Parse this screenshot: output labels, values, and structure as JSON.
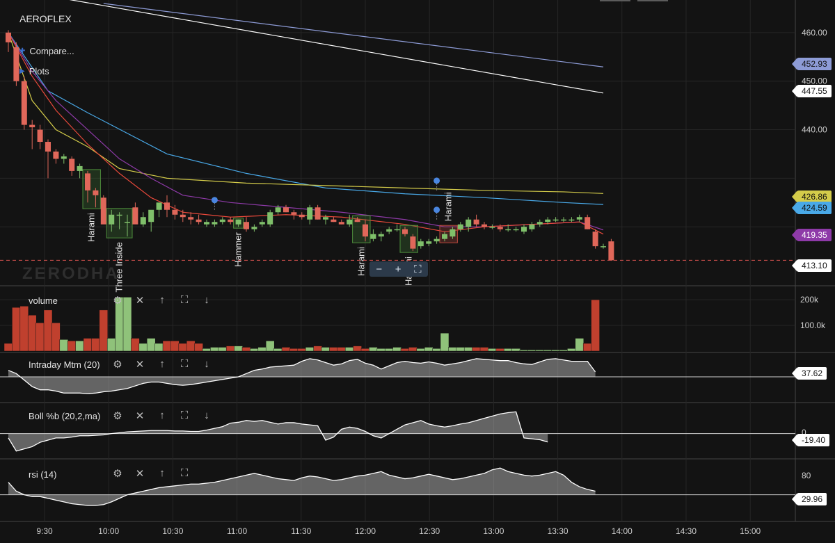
{
  "app": {
    "symbol": "AEROFLEX",
    "watermark": "ZERODHA",
    "menu": [
      {
        "label": "Compare..."
      },
      {
        "label": "Plots"
      }
    ]
  },
  "panes": {
    "volume": {
      "label": "volume"
    },
    "mtm": {
      "label": "Intraday Mtm (20)"
    },
    "boll": {
      "label": "Boll %b (20,2,ma)"
    },
    "rsi": {
      "label": "rsi (14)"
    }
  },
  "tools": {
    "settings": "⚙",
    "close": "✕",
    "up": "↑",
    "expand": "⛶",
    "down": "↓"
  },
  "zoom": {
    "minus": "−",
    "plus": "+",
    "reset": "⛶"
  },
  "price_tags": [
    {
      "value": "452.93",
      "color": "#8d9bd6",
      "text_color": "#111111"
    },
    {
      "value": "447.55",
      "color": "#ffffff",
      "text_color": "#111111"
    },
    {
      "value": "426.86",
      "color": "#d4cc4a",
      "text_color": "#111111"
    },
    {
      "value": "424.59",
      "color": "#49a9e8",
      "text_color": "#111111"
    },
    {
      "value": "419.35",
      "color": "#8e3aa8",
      "text_color": "#ffffff"
    },
    {
      "value": "413.10",
      "color": "#ffffff",
      "text_color": "#111111"
    }
  ],
  "indicator_tags": {
    "mtm": "37.62",
    "boll": "-19.40",
    "rsi": "29.96"
  },
  "chart_data": {
    "type": "candlestick",
    "symbol": "AEROFLEX",
    "ylim": [
      408,
      466
    ],
    "y_ticks": [
      440,
      450,
      460
    ],
    "y_tick_labels": [
      "440.00",
      "450.00",
      "460.00"
    ],
    "x_ticks": [
      "9:30",
      "10:00",
      "10:30",
      "11:00",
      "11:30",
      "12:00",
      "12:30",
      "13:00",
      "13:30",
      "14:00",
      "14:30",
      "15:00"
    ],
    "candles": [
      {
        "o": 460,
        "h": 460.5,
        "l": 456,
        "c": 458
      },
      {
        "o": 457,
        "h": 458,
        "l": 449,
        "c": 450
      },
      {
        "o": 450,
        "h": 451,
        "l": 440,
        "c": 441
      },
      {
        "o": 441,
        "h": 442,
        "l": 436,
        "c": 440.5
      },
      {
        "o": 440,
        "h": 441,
        "l": 436,
        "c": 437.5
      },
      {
        "o": 437.5,
        "h": 438,
        "l": 430,
        "c": 435.5
      },
      {
        "o": 435.5,
        "h": 436,
        "l": 433,
        "c": 434
      },
      {
        "o": 434,
        "h": 435,
        "l": 433,
        "c": 434.5
      },
      {
        "o": 434,
        "h": 434.5,
        "l": 430.5,
        "c": 431.5
      },
      {
        "o": 431.5,
        "h": 433,
        "l": 430,
        "c": 432.5
      },
      {
        "o": 431,
        "h": 431.5,
        "l": 425,
        "c": 427.5
      },
      {
        "o": 427.5,
        "h": 428,
        "l": 424,
        "c": 426.5
      },
      {
        "o": 426,
        "h": 426.5,
        "l": 421,
        "c": 420.5
      },
      {
        "o": 420.5,
        "h": 423.5,
        "l": 419,
        "c": 422.5
      },
      {
        "o": 422.5,
        "h": 423,
        "l": 419.5,
        "c": 422.5
      },
      {
        "o": 421,
        "h": 422.5,
        "l": 418,
        "c": 421
      },
      {
        "o": 424,
        "h": 425,
        "l": 421.5,
        "c": 420.5
      },
      {
        "o": 420.5,
        "h": 423,
        "l": 420,
        "c": 422
      },
      {
        "o": 421,
        "h": 423,
        "l": 419,
        "c": 423.5
      },
      {
        "o": 423.5,
        "h": 424.5,
        "l": 422,
        "c": 425
      },
      {
        "o": 425,
        "h": 426.5,
        "l": 422,
        "c": 423.5
      },
      {
        "o": 423.5,
        "h": 424.5,
        "l": 421.5,
        "c": 422.5
      },
      {
        "o": 422.5,
        "h": 423.5,
        "l": 421,
        "c": 422
      },
      {
        "o": 422,
        "h": 423,
        "l": 420.5,
        "c": 421.5
      },
      {
        "o": 421.5,
        "h": 422.5,
        "l": 420.5,
        "c": 421
      },
      {
        "o": 420.5,
        "h": 421.5,
        "l": 420,
        "c": 421
      },
      {
        "o": 420.5,
        "h": 421.5,
        "l": 420,
        "c": 421
      },
      {
        "o": 421,
        "h": 422,
        "l": 420.5,
        "c": 421.5
      },
      {
        "o": 421.5,
        "h": 422,
        "l": 420.5,
        "c": 421
      },
      {
        "o": 420.5,
        "h": 421.5,
        "l": 420,
        "c": 421.5
      },
      {
        "o": 421,
        "h": 422,
        "l": 419,
        "c": 419.5
      },
      {
        "o": 419.5,
        "h": 420.5,
        "l": 419,
        "c": 420
      },
      {
        "o": 420.5,
        "h": 421.5,
        "l": 420,
        "c": 421
      },
      {
        "o": 420.5,
        "h": 423.5,
        "l": 420,
        "c": 423
      },
      {
        "o": 423,
        "h": 424.5,
        "l": 422.5,
        "c": 424
      },
      {
        "o": 424,
        "h": 424.5,
        "l": 423,
        "c": 423
      },
      {
        "o": 423,
        "h": 423.5,
        "l": 421.5,
        "c": 422.5
      },
      {
        "o": 422.5,
        "h": 423,
        "l": 421.5,
        "c": 422
      },
      {
        "o": 421.5,
        "h": 424.5,
        "l": 420.5,
        "c": 424
      },
      {
        "o": 424,
        "h": 424.5,
        "l": 421.5,
        "c": 421.5
      },
      {
        "o": 421.5,
        "h": 422.5,
        "l": 420.5,
        "c": 422
      },
      {
        "o": 421.5,
        "h": 422,
        "l": 421,
        "c": 421
      },
      {
        "o": 421,
        "h": 421.5,
        "l": 420.5,
        "c": 420.5
      },
      {
        "o": 420.5,
        "h": 422.5,
        "l": 420,
        "c": 421.5
      },
      {
        "o": 421.5,
        "h": 422,
        "l": 421,
        "c": 421
      },
      {
        "o": 420.5,
        "h": 421.5,
        "l": 417,
        "c": 418
      },
      {
        "o": 417.5,
        "h": 419.5,
        "l": 417,
        "c": 418.5
      },
      {
        "o": 418,
        "h": 419,
        "l": 417,
        "c": 418.5
      },
      {
        "o": 419,
        "h": 420,
        "l": 418.5,
        "c": 419.5
      },
      {
        "o": 419.5,
        "h": 420.5,
        "l": 419,
        "c": 419.5
      },
      {
        "o": 419.5,
        "h": 420,
        "l": 418,
        "c": 418.5
      },
      {
        "o": 418,
        "h": 418.5,
        "l": 415,
        "c": 415.5
      },
      {
        "o": 416,
        "h": 417.5,
        "l": 415.5,
        "c": 417
      },
      {
        "o": 416.5,
        "h": 417.5,
        "l": 416,
        "c": 417
      },
      {
        "o": 417,
        "h": 418,
        "l": 416.5,
        "c": 417.5
      },
      {
        "o": 417.5,
        "h": 419,
        "l": 417,
        "c": 418.5
      },
      {
        "o": 418,
        "h": 420,
        "l": 417.5,
        "c": 419.5
      },
      {
        "o": 419.5,
        "h": 421,
        "l": 419,
        "c": 420.5
      },
      {
        "o": 420,
        "h": 422,
        "l": 419,
        "c": 421.5
      },
      {
        "o": 421.5,
        "h": 422.5,
        "l": 420,
        "c": 420.5
      },
      {
        "o": 420.5,
        "h": 421,
        "l": 419.5,
        "c": 420
      },
      {
        "o": 420,
        "h": 420.5,
        "l": 419.5,
        "c": 420
      },
      {
        "o": 420,
        "h": 420.5,
        "l": 419,
        "c": 419.5
      },
      {
        "o": 419.5,
        "h": 420.5,
        "l": 419,
        "c": 419.5
      },
      {
        "o": 419.5,
        "h": 420,
        "l": 419,
        "c": 419.5
      },
      {
        "o": 419,
        "h": 420.5,
        "l": 418.5,
        "c": 420
      },
      {
        "o": 419.5,
        "h": 421,
        "l": 419,
        "c": 420.5
      },
      {
        "o": 420.5,
        "h": 421.5,
        "l": 420,
        "c": 421
      },
      {
        "o": 421,
        "h": 422,
        "l": 420.5,
        "c": 421.5
      },
      {
        "o": 421.5,
        "h": 422,
        "l": 421,
        "c": 421.5
      },
      {
        "o": 421.5,
        "h": 422,
        "l": 421,
        "c": 421.5
      },
      {
        "o": 421.5,
        "h": 422,
        "l": 421,
        "c": 421.5
      },
      {
        "o": 421.5,
        "h": 422.5,
        "l": 421,
        "c": 422
      },
      {
        "o": 422,
        "h": 422.5,
        "l": 419.5,
        "c": 419.5
      },
      {
        "o": 419,
        "h": 419.5,
        "l": 415.5,
        "c": 416
      },
      {
        "o": 416,
        "h": 416.5,
        "l": 415.5,
        "c": 416
      },
      {
        "o": 417,
        "h": 417.5,
        "l": 413,
        "c": 413.1
      }
    ],
    "lines": [
      {
        "color": "#ffffff",
        "values": [
          [
            0,
            469
          ],
          [
            75,
            447.55
          ]
        ]
      },
      {
        "color": "#8d9bd6",
        "values": [
          [
            12,
            466
          ],
          [
            75,
            452.93
          ]
        ]
      },
      {
        "color": "#49a9e8",
        "values": [
          [
            0,
            460
          ],
          [
            5,
            448
          ],
          [
            10,
            443.5
          ],
          [
            20,
            435
          ],
          [
            30,
            431
          ],
          [
            40,
            428
          ],
          [
            50,
            426.8
          ],
          [
            60,
            426
          ],
          [
            70,
            425
          ],
          [
            75,
            424.59
          ]
        ]
      },
      {
        "color": "#d4cc4a",
        "values": [
          [
            0,
            460
          ],
          [
            3,
            446
          ],
          [
            6,
            440
          ],
          [
            10,
            436.5
          ],
          [
            14,
            432
          ],
          [
            20,
            430
          ],
          [
            30,
            429
          ],
          [
            40,
            428.5
          ],
          [
            50,
            428
          ],
          [
            60,
            427.5
          ],
          [
            70,
            427.2
          ],
          [
            75,
            426.86
          ]
        ]
      },
      {
        "color": "#8e3aa8",
        "values": [
          [
            0,
            460
          ],
          [
            3,
            452
          ],
          [
            6,
            446
          ],
          [
            10,
            440
          ],
          [
            14,
            434
          ],
          [
            18,
            430
          ],
          [
            22,
            426.5
          ],
          [
            28,
            425
          ],
          [
            35,
            424
          ],
          [
            42,
            423
          ],
          [
            50,
            421.5
          ],
          [
            55,
            420
          ],
          [
            60,
            420
          ],
          [
            66,
            420.5
          ],
          [
            72,
            421
          ],
          [
            75,
            419.35
          ]
        ]
      },
      {
        "color": "#e8483a",
        "values": [
          [
            0,
            460
          ],
          [
            3,
            451
          ],
          [
            6,
            444
          ],
          [
            10,
            437
          ],
          [
            14,
            431
          ],
          [
            18,
            426
          ],
          [
            22,
            423
          ],
          [
            28,
            422
          ],
          [
            35,
            422.5
          ],
          [
            42,
            422
          ],
          [
            50,
            420.5
          ],
          [
            55,
            419
          ],
          [
            60,
            420
          ],
          [
            66,
            420.5
          ],
          [
            72,
            421
          ],
          [
            75,
            418.5
          ]
        ]
      }
    ],
    "patterns": [
      {
        "label": "Harami",
        "from": 10,
        "to": 11,
        "color": "green"
      },
      {
        "label": "Three Inside",
        "from": 13,
        "to": 15,
        "color": "green"
      },
      {
        "label": "Hammer",
        "from": 29,
        "to": 29,
        "color": "green"
      },
      {
        "label": "Harami",
        "from": 44,
        "to": 45,
        "color": "green"
      },
      {
        "label": "Harami",
        "from": 50,
        "to": 51,
        "color": "green"
      },
      {
        "label": "Harami",
        "from": 55,
        "to": 56,
        "color": "red"
      }
    ],
    "volume": {
      "y_ticks": [
        100000,
        200000
      ],
      "y_tick_labels": [
        "100.0k",
        "200k"
      ],
      "ylim": [
        0,
        230000
      ],
      "values": [
        30000,
        170000,
        175000,
        140000,
        110000,
        160000,
        110000,
        45000,
        40000,
        40000,
        50000,
        50000,
        160000,
        50000,
        210000,
        210000,
        50000,
        30000,
        50000,
        30000,
        40000,
        40000,
        30000,
        40000,
        30000,
        10000,
        15000,
        15000,
        20000,
        20000,
        15000,
        10000,
        15000,
        40000,
        10000,
        15000,
        10000,
        10000,
        15000,
        20000,
        15000,
        15000,
        15000,
        15000,
        20000,
        10000,
        15000,
        10000,
        10000,
        15000,
        10000,
        15000,
        10000,
        15000,
        10000,
        70000,
        15000,
        15000,
        15000,
        15000,
        15000,
        10000,
        10000,
        10000,
        10000,
        5000,
        5000,
        5000,
        5000,
        5000,
        5000,
        10000,
        50000,
        30000,
        200000
      ]
    },
    "mtm": {
      "values": [
        40,
        35,
        25,
        15,
        10,
        10,
        8,
        5,
        5,
        5,
        4,
        5,
        7,
        8,
        10,
        12,
        16,
        20,
        22,
        22,
        20,
        18,
        17,
        18,
        20,
        22,
        24,
        26,
        28,
        30,
        35,
        40,
        42,
        45,
        46,
        47,
        48,
        54,
        58,
        56,
        52,
        48,
        50,
        55,
        57,
        51,
        48,
        42,
        47,
        52,
        54,
        52,
        51,
        53,
        51,
        48,
        50,
        52,
        55,
        58,
        57,
        56,
        55,
        55,
        52,
        50,
        49,
        53,
        57,
        58,
        56,
        54,
        54,
        54,
        37.62
      ]
    },
    "boll": {
      "values": [
        -10,
        -40,
        -35,
        -30,
        -20,
        -15,
        -10,
        -10,
        -8,
        -5,
        -5,
        -4,
        -3,
        0,
        2,
        4,
        5,
        6,
        7,
        7,
        7,
        6,
        6,
        5,
        5,
        8,
        12,
        16,
        24,
        26,
        30,
        28,
        30,
        26,
        22,
        25,
        25,
        22,
        20,
        18,
        -15,
        -8,
        10,
        15,
        12,
        5,
        -5,
        -10,
        0,
        10,
        20,
        25,
        30,
        22,
        18,
        15,
        18,
        22,
        25,
        30,
        35,
        40,
        45,
        48,
        50,
        -10,
        -12,
        -14,
        -19.4
      ]
    },
    "rsi": {
      "y_ticks": [
        80
      ],
      "y_tick_labels": [
        "80"
      ],
      "values": [
        40,
        30,
        26,
        24,
        24,
        22,
        20,
        18,
        16,
        15,
        14,
        14,
        15,
        18,
        22,
        26,
        28,
        30,
        32,
        34,
        35,
        36,
        37,
        38,
        38,
        39,
        40,
        42,
        44,
        46,
        48,
        50,
        48,
        46,
        44,
        43,
        42,
        45,
        47,
        46,
        44,
        42,
        43,
        45,
        47,
        48,
        50,
        52,
        48,
        46,
        44,
        45,
        47,
        49,
        47,
        45,
        43,
        44,
        46,
        48,
        50,
        54,
        56,
        52,
        50,
        48,
        47,
        48,
        50,
        52,
        48,
        40,
        35,
        32,
        29.96
      ]
    }
  }
}
